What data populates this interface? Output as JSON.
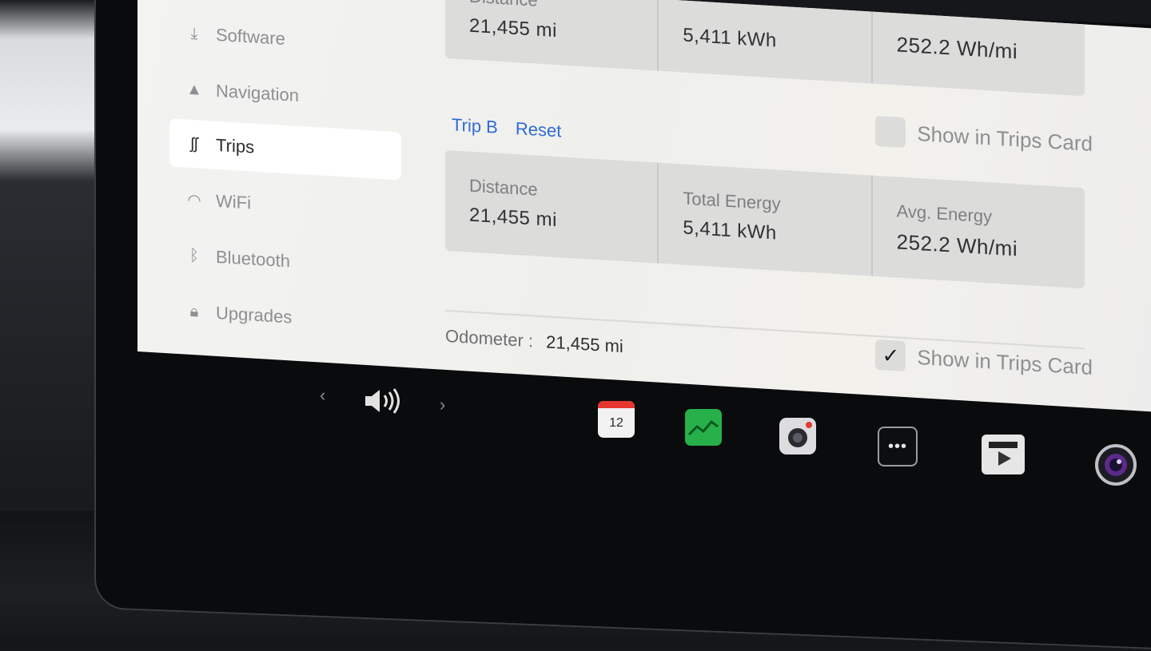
{
  "sidebar": {
    "items": [
      {
        "label": "Software",
        "icon": "download-icon"
      },
      {
        "label": "Navigation",
        "icon": "navigation-arrow-icon"
      },
      {
        "label": "Trips",
        "icon": "trips-icon",
        "active": true
      },
      {
        "label": "WiFi",
        "icon": "wifi-icon"
      },
      {
        "label": "Bluetooth",
        "icon": "bluetooth-icon"
      },
      {
        "label": "Upgrades",
        "icon": "lock-icon"
      }
    ]
  },
  "trip_a": {
    "distance_label": "Distance",
    "distance": "21,455 mi",
    "energy": "5,411 kWh",
    "avg_energy": "252.2 Wh/mi"
  },
  "trip_b": {
    "title": "Trip B",
    "reset": "Reset",
    "show_in_trips_card": "Show in Trips Card",
    "show_checked": false,
    "distance_label": "Distance",
    "distance": "21,455 mi",
    "energy_label": "Total Energy",
    "energy": "5,411 kWh",
    "avg_label": "Avg. Energy",
    "avg_energy": "252.2 Wh/mi"
  },
  "odometer": {
    "label": "Odometer :",
    "value": "21,455 mi",
    "show_in_trips_card": "Show in Trips Card",
    "show_checked": true
  },
  "dock": {
    "calendar_day": "12",
    "more_label": "•••",
    "accent_red": "#e5362f",
    "accent_green": "#27b04a",
    "apps": [
      "calendar-icon",
      "stocks-icon",
      "camera-icon",
      "more-icon",
      "theater-icon",
      "lens-icon"
    ]
  }
}
